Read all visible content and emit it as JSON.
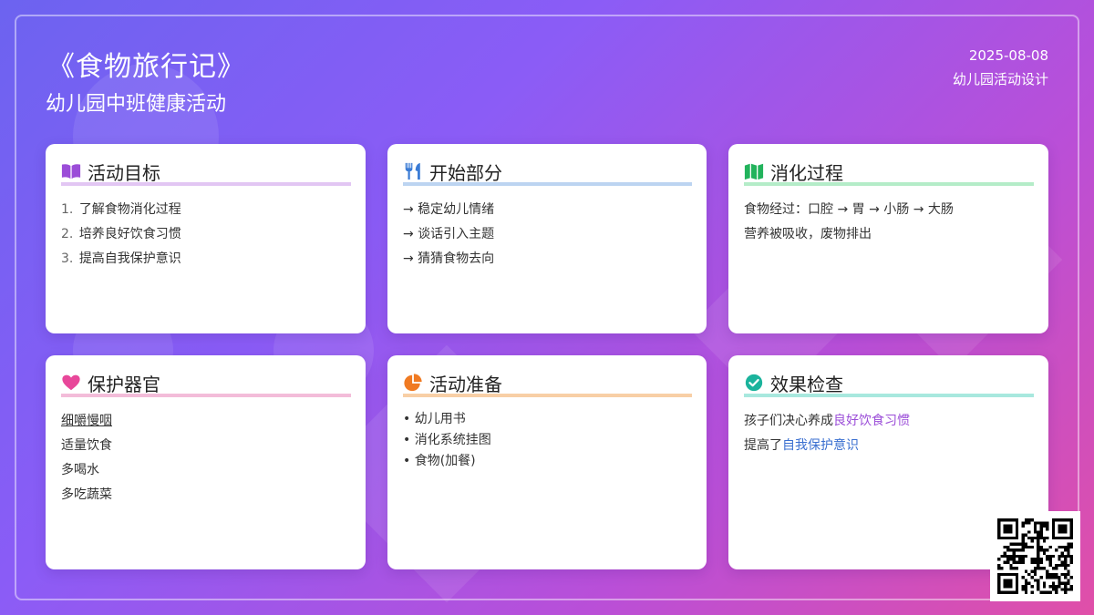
{
  "header": {
    "title": "《食物旅行记》",
    "subtitle": "幼儿园中班健康活动",
    "date": "2025-08-08",
    "org": "幼儿园活动设计"
  },
  "colors": {
    "accent_purple": "#9b4dd8",
    "accent_blue": "#3a6fd0",
    "accent_green": "#22b35c",
    "accent_pink": "#e8479a",
    "accent_orange": "#f07a22",
    "accent_teal": "#1bb39c"
  },
  "cards": [
    {
      "title": "活动目标",
      "icon": "book-open-icon",
      "items": [
        "1.",
        "了解食物消化过程",
        "2.",
        "培养良好饮食习惯",
        "3.",
        "提高自我保护意识"
      ]
    },
    {
      "title": "开始部分",
      "icon": "utensils-icon",
      "items": [
        "→ 稳定幼儿情绪",
        "→ 谈话引入主题",
        "→ 猜猜食物去向"
      ]
    },
    {
      "title": "消化过程",
      "icon": "map-icon",
      "items": [
        "食物经过：口腔 → 胃 → 小肠 → 大肠",
        "营养被吸收，废物排出"
      ]
    },
    {
      "title": "保护器官",
      "icon": "heart-icon",
      "items": [
        "细嚼慢咽",
        "适量饮食",
        "多喝水",
        "多吃蔬菜"
      ]
    },
    {
      "title": "活动准备",
      "icon": "pie-chart-icon",
      "items": [
        "• 幼儿用书",
        "• 消化系统挂图",
        "• 食物(加餐)"
      ]
    },
    {
      "title": "效果检查",
      "icon": "check-circle-icon",
      "line1_prefix": "孩子们决心养成",
      "line1_highlight": "良好饮食习惯",
      "line2_prefix": "提高了",
      "line2_highlight": "自我保护意识"
    }
  ],
  "qr": {
    "icon": "qr-code-icon"
  }
}
